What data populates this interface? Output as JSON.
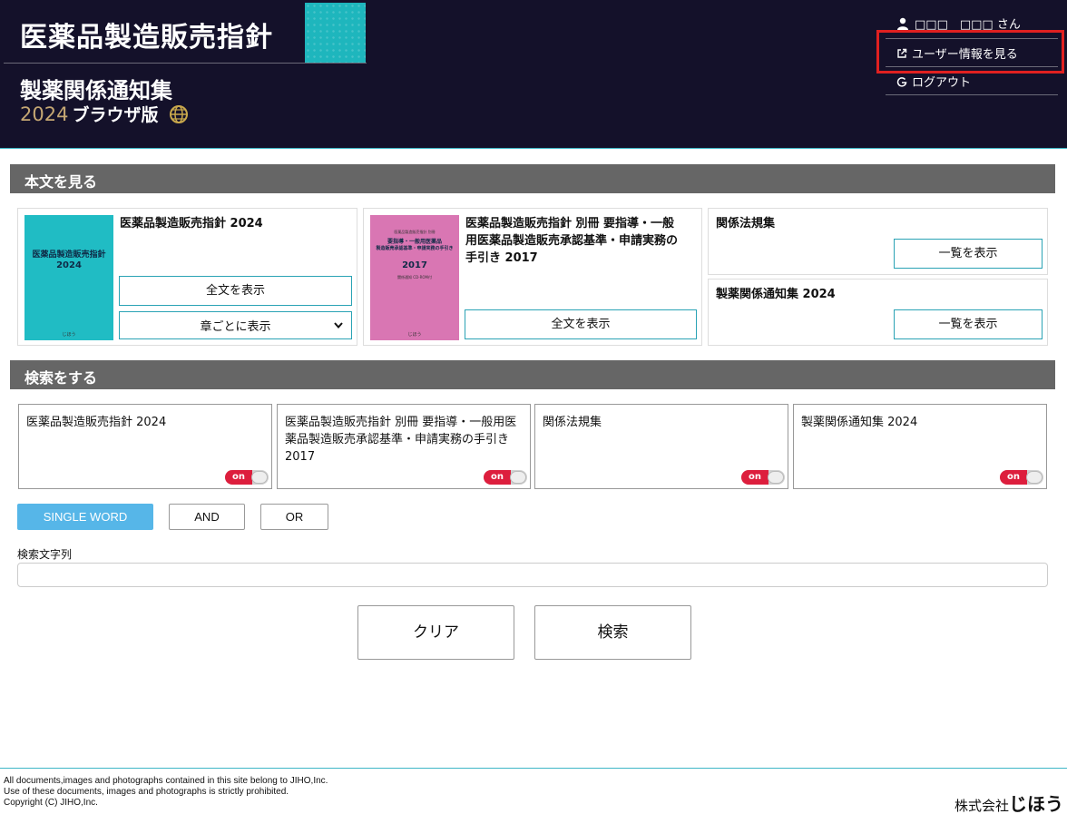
{
  "header": {
    "title": "医薬品製造販売指針",
    "subtitle": "製薬関係通知集",
    "edition_year": "2024",
    "edition_label": "ブラウザ版"
  },
  "user_menu": {
    "user_name": "□□□　□□□ さん",
    "profile_link": "ユーザー情報を見る",
    "logout_link": "ログアウト"
  },
  "view_section": {
    "heading": "本文を見る",
    "book1": {
      "title": "医薬品製造販売指針 2024",
      "cover_title": "医薬品製造販売指針",
      "cover_year": "2024",
      "cover_publisher": "じほう",
      "full_text_button": "全文を表示",
      "chapter_select": "章ごとに表示"
    },
    "book2": {
      "title": "医薬品製造販売指針 別冊 要指導・一般用医薬品製造販売承認基準・申請実務の手引き 2017",
      "cover_line1": "医薬品製造販売指針 別冊",
      "cover_line2": "要指導・一般用医薬品",
      "cover_line3": "製造販売承認基準・申請実務の手引き",
      "cover_year": "2017",
      "cover_note": "関係通知 CD-ROM付",
      "cover_publisher": "じほう",
      "full_text_button": "全文を表示"
    },
    "laws": {
      "title": "関係法規集",
      "list_button": "一覧を表示"
    },
    "notices": {
      "title": "製薬関係通知集 2024",
      "list_button": "一覧を表示"
    }
  },
  "search_section": {
    "heading": "検索をする",
    "targets": [
      {
        "label": "医薬品製造販売指針 2024",
        "toggle": "on"
      },
      {
        "label": "医薬品製造販売指針 別冊 要指導・一般用医薬品製造販売承認基準・申請実務の手引き 2017",
        "toggle": "on"
      },
      {
        "label": "関係法規集",
        "toggle": "on"
      },
      {
        "label": "製薬関係通知集 2024",
        "toggle": "on"
      }
    ],
    "modes": {
      "single": "SINGLE WORD",
      "and": "AND",
      "or": "OR",
      "active": "SINGLE WORD"
    },
    "query_label": "検索文字列",
    "query_value": "",
    "clear_button": "クリア",
    "search_button": "検索"
  },
  "footer": {
    "line1": "All documents,images and photographs contained in this site belong to JIHO,Inc.",
    "line2": "Use of these documents, images and photographs is strictly prohibited.",
    "line3": "Copyright (C) JIHO,Inc.",
    "company_prefix": "株式会社",
    "company_name": "じほう"
  },
  "colors": {
    "header_bg": "#14112a",
    "accent_teal": "#2aa3b5",
    "toggle_on": "#dd1e3d",
    "mode_active": "#56b6e8",
    "highlight": "#e02020"
  }
}
